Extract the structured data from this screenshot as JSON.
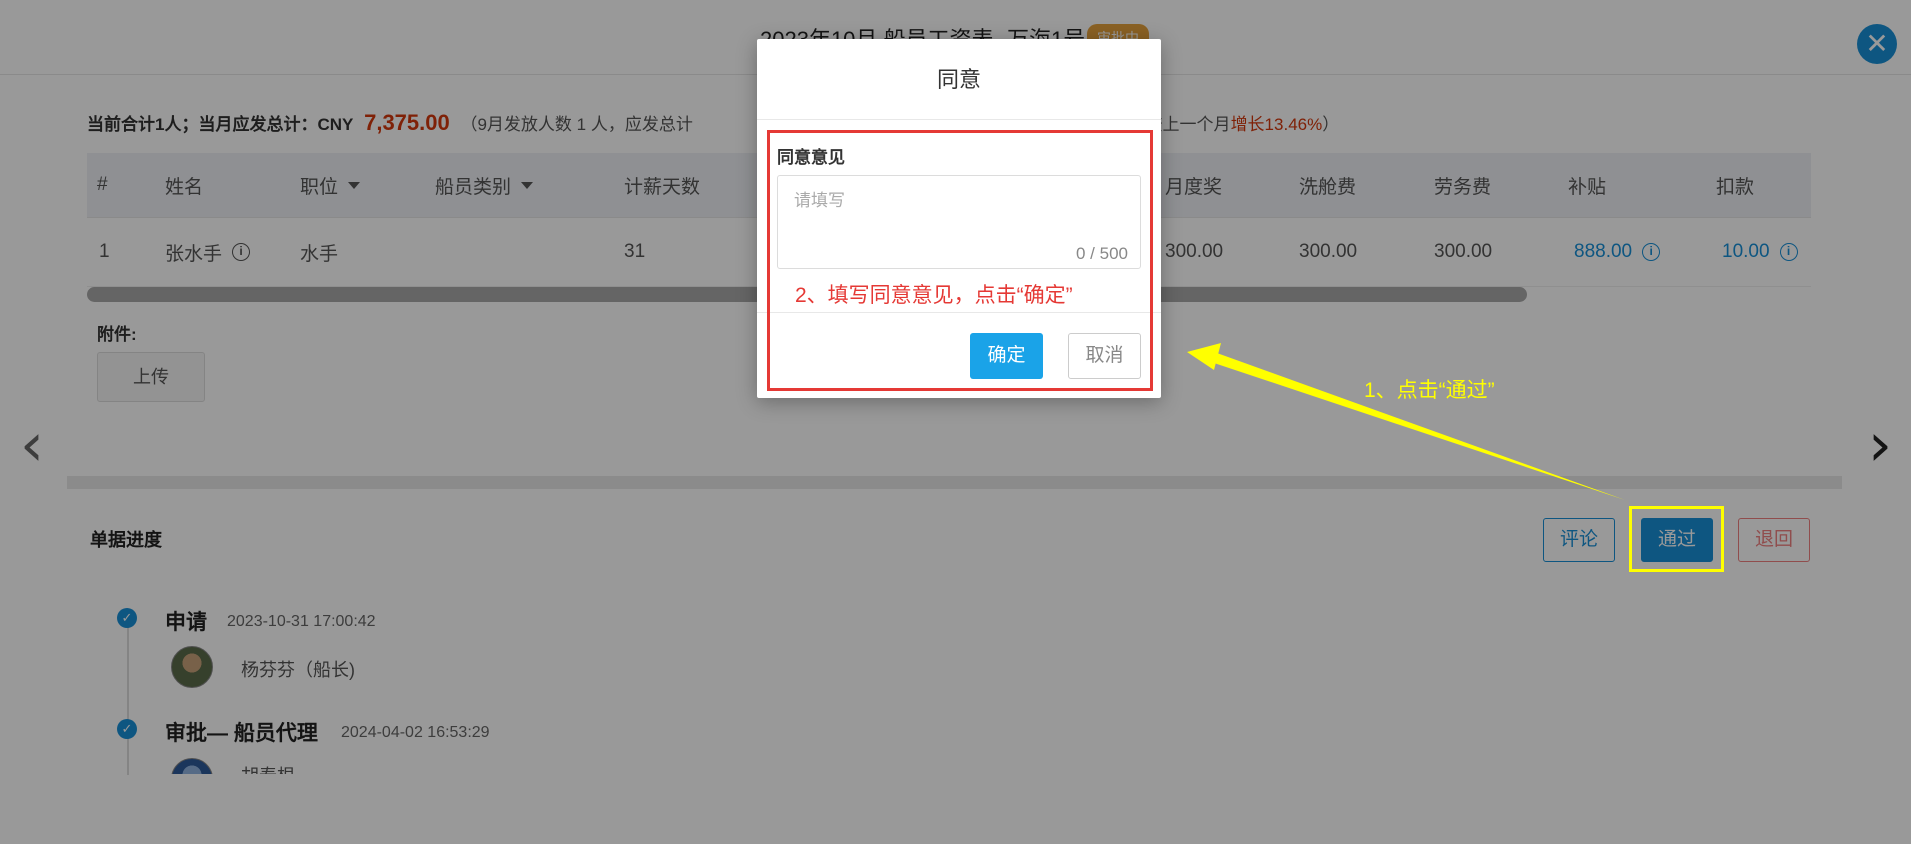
{
  "header": {
    "title": "2023年10月 船员工资表 -万海1号",
    "status": "审批中"
  },
  "summary": {
    "prefix": "当前合计1人；当月应发总计：CNY",
    "amount": "7,375.00",
    "detail_open": "（9月发放人数 1 人，应发总计",
    "detail_mid": "应发总计较上一个月",
    "growth": "增长13.46%",
    "detail_close": "）"
  },
  "table": {
    "headers": {
      "index": "#",
      "name": "姓名",
      "position": "职位",
      "crew_type": "船员类别",
      "pay_days": "计薪天数",
      "monthly_bonus": "月度奖",
      "cleaning_fee": "洗舱费",
      "labor_fee": "劳务费",
      "allowance": "补贴",
      "deduction": "扣款"
    },
    "rows": [
      {
        "index": "1",
        "name": "张水手",
        "position": "水手",
        "pay_days": "31",
        "monthly_bonus": "300.00",
        "cleaning_fee": "300.00",
        "labor_fee": "300.00",
        "allowance": "888.00",
        "deduction": "10.00"
      }
    ]
  },
  "attachments": {
    "label": "附件:",
    "upload_label": "上传"
  },
  "progress": {
    "title": "单据进度",
    "comment_label": "评论",
    "pass_label": "通过",
    "return_label": "退回",
    "steps": [
      {
        "title": "申请",
        "time": "2023-10-31 17:00:42",
        "person": "杨芬芬（船长)"
      },
      {
        "title": "审批— 船员代理",
        "time": "2024-04-02 16:53:29",
        "person": "胡寿根"
      }
    ]
  },
  "modal": {
    "title": "同意",
    "field_label": "同意意见",
    "placeholder": "请填写",
    "char_count": "0 / 500",
    "ok_label": "确定",
    "cancel_label": "取消"
  },
  "annotations": {
    "step1": "1、点击“通过”",
    "step2": "2、填写同意意见，点击“确定”"
  },
  "icons": {
    "close": "close-icon",
    "info": "info-icon",
    "check": "check-icon",
    "caret": "caret-down-icon",
    "prev": "chevron-left-icon",
    "next": "chevron-right-icon"
  },
  "colors": {
    "primary": "#1890d8",
    "amount_red": "#d4380d",
    "status_tag": "#e6a23c",
    "annotation_yellow": "#ffff00",
    "annotation_red": "#e53935"
  }
}
